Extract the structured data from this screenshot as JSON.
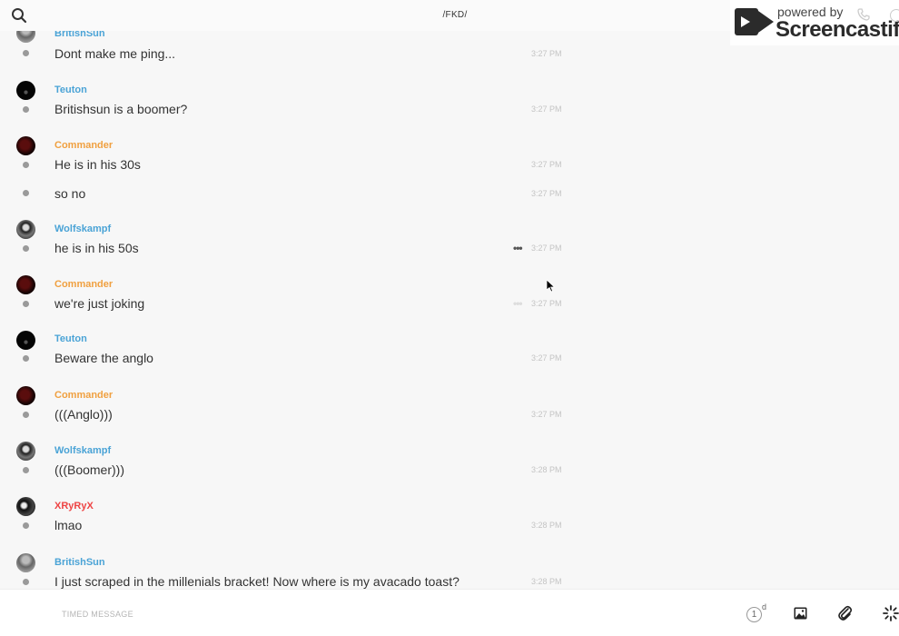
{
  "header": {
    "channel": "/FKD/",
    "search_icon": "search-icon"
  },
  "watermark": {
    "powered": "powered by",
    "brand": "Screencastify"
  },
  "messages": [
    {
      "author": "BritishSun",
      "color": "#4aa3d6",
      "text": "Dont make me ping...",
      "time": "3:27 PM"
    },
    {
      "author": "Teuton",
      "color": "#4aa3d6",
      "text": "Britishsun is a boomer?",
      "time": "3:27 PM"
    },
    {
      "author": "Commander",
      "color": "#f0a040",
      "text": "He is in his 30s",
      "time": "3:27 PM"
    },
    {
      "author": "",
      "text": "so no",
      "time": "3:27 PM"
    },
    {
      "author": "Wolfskampf",
      "color": "#4aa3d6",
      "text": "he is in his 50s",
      "time": "3:27 PM",
      "more": "•••"
    },
    {
      "author": "Commander",
      "color": "#f0a040",
      "text": "we're just joking",
      "time": "3:27 PM",
      "more": "•••"
    },
    {
      "author": "Teuton",
      "color": "#4aa3d6",
      "text": "Beware the anglo",
      "time": "3:27 PM"
    },
    {
      "author": "Commander",
      "color": "#f0a040",
      "text": "(((Anglo)))",
      "time": "3:27 PM"
    },
    {
      "author": "Wolfskampf",
      "color": "#4aa3d6",
      "text": "(((Boomer)))",
      "time": "3:28 PM"
    },
    {
      "author": "XRyRyX",
      "color": "#e44444",
      "text": "lmao",
      "time": "3:28 PM"
    },
    {
      "author": "BritishSun",
      "color": "#4aa3d6",
      "text": "I just scraped in the millenials bracket!  Now where is my avacado toast?",
      "time": "3:28 PM"
    }
  ],
  "composer": {
    "placeholder": "TIMED MESSAGE",
    "timer_value": "1",
    "timer_unit": "d"
  }
}
